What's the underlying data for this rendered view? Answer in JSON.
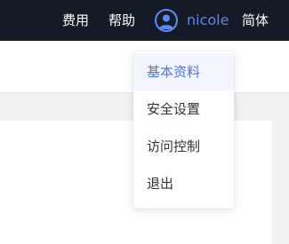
{
  "header": {
    "fees_label": "费用",
    "help_label": "帮助",
    "username": "nicole",
    "language_label": "简体",
    "accent_color": "#5a87f5",
    "background_color": "#141b27"
  },
  "user_menu": {
    "items": [
      {
        "label": "基本资料",
        "active": true
      },
      {
        "label": "安全设置",
        "active": false
      },
      {
        "label": "访问控制",
        "active": false
      },
      {
        "label": "退出",
        "active": false
      }
    ]
  },
  "icons": {
    "avatar": "user-avatar-icon"
  }
}
